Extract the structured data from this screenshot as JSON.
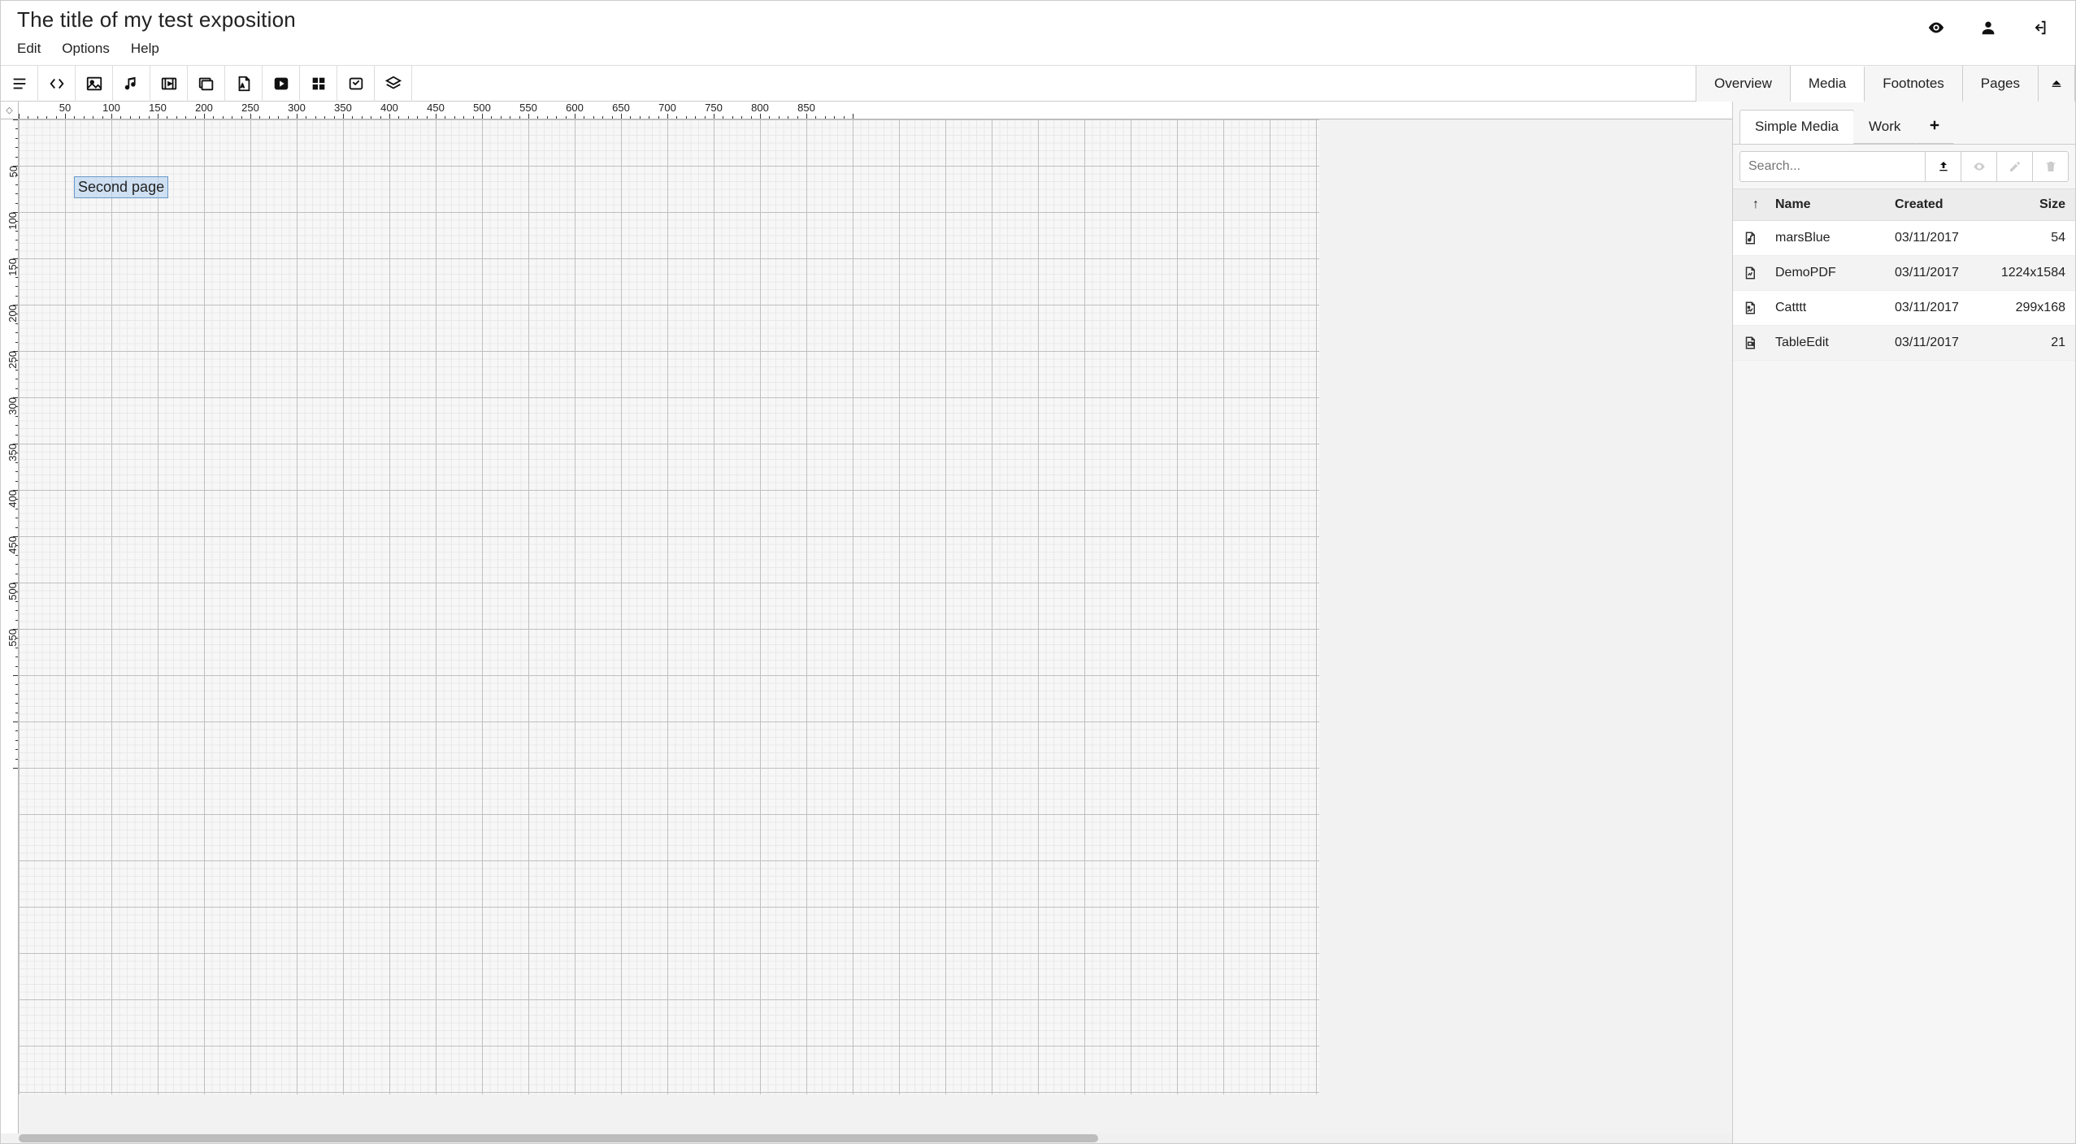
{
  "header": {
    "title": "The title of my test exposition",
    "menu": {
      "edit": "Edit",
      "options": "Options",
      "help": "Help"
    }
  },
  "toolbar_icons": [
    "text",
    "code",
    "image",
    "audio",
    "video",
    "slideshow",
    "pdf",
    "play",
    "shapes",
    "object",
    "layers"
  ],
  "side_tabs": {
    "overview": "Overview",
    "media": "Media",
    "footnotes": "Footnotes",
    "pages": "Pages"
  },
  "canvas": {
    "item_text": "Second page"
  },
  "media_panel": {
    "sub_tabs": {
      "simple": "Simple Media",
      "work": "Work"
    },
    "search_placeholder": "Search...",
    "columns": {
      "sort": "↑",
      "name": "Name",
      "created": "Created",
      "size": "Size"
    },
    "rows": [
      {
        "icon": "audio",
        "name": "marsBlue",
        "created": "03/11/2017",
        "size": "54"
      },
      {
        "icon": "pdf",
        "name": "DemoPDF",
        "created": "03/11/2017",
        "size": "1224x1584"
      },
      {
        "icon": "image",
        "name": "Catttt",
        "created": "03/11/2017",
        "size": "299x168"
      },
      {
        "icon": "video",
        "name": "TableEdit",
        "created": "03/11/2017",
        "size": "21"
      }
    ]
  },
  "ruler_marks": [
    50,
    100,
    150,
    200,
    250,
    300,
    350,
    400,
    450,
    500,
    550,
    600,
    650,
    700,
    750,
    800,
    850
  ]
}
